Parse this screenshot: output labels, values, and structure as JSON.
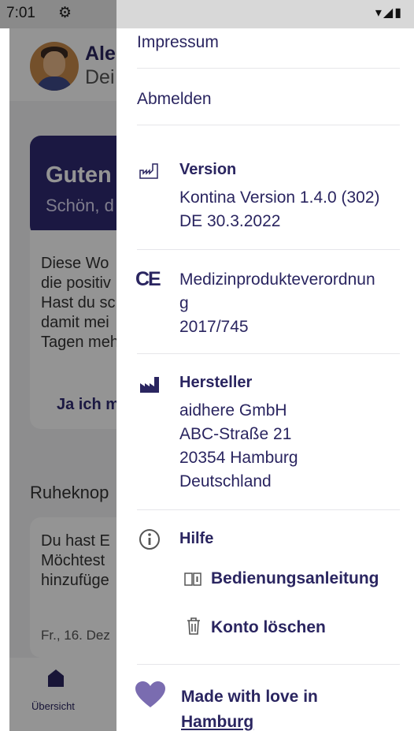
{
  "status_bar": {
    "time": "7:01",
    "settings_glyph": "⚙",
    "right_icons": "▾◢▮"
  },
  "background": {
    "header_name": "Ale",
    "header_sub": "Dei",
    "greet_title": "Guten",
    "greet_sub": "Schön, d",
    "info_text": "Diese Wo\ndie positiv\nHast du sc\ndamit mei\nTagen meh",
    "info_button": "Ja ich m",
    "section_title": "Ruheknop",
    "note_text": "Du hast E\nMöchtest\nhinzufüge",
    "note_date": "Fr., 16. Dez",
    "nav_home_label": "Übersicht"
  },
  "drawer": {
    "impressum": "Impressum",
    "logout": "Abmelden",
    "version": {
      "title": "Version",
      "line1": "Kontina Version 1.4.0 (302)",
      "line2": "DE 30.3.2022"
    },
    "mdr": {
      "line1": "Medizinprodukteverordnun",
      "line2": "g",
      "line3": "2017/745",
      "ce": "CE"
    },
    "manufacturer": {
      "title": "Hersteller",
      "name": "aidhere GmbH",
      "street": "ABC-Straße 21",
      "city": "20354 Hamburg",
      "country": "Deutschland"
    },
    "help": {
      "title": "Hilfe",
      "manual": "Bedienungsanleitung",
      "delete_account": "Konto löschen"
    },
    "footer": {
      "line1": "Made with love in",
      "line2": "Hamburg"
    }
  },
  "colors": {
    "accent": "#2a2560",
    "heart": "#7a6cb0"
  },
  "icons": {
    "version": "date-of-manufacture-icon",
    "manufacturer": "factory-icon",
    "help": "info-icon",
    "manual": "book-icon",
    "delete": "trash-icon",
    "footer": "heart-icon"
  }
}
